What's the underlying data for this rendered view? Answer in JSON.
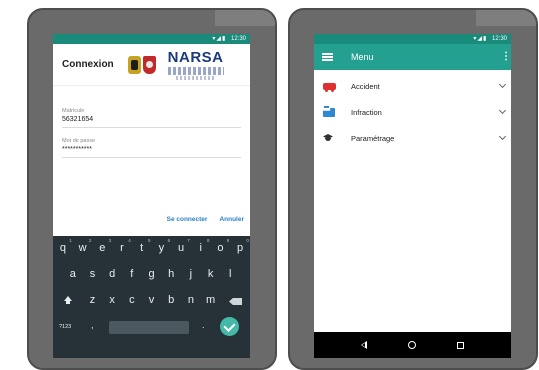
{
  "status": {
    "time": "12:30"
  },
  "login": {
    "title": "Connexion",
    "logo_text": "NARSA",
    "matricule_label": "Matricule",
    "matricule_value": "56321654",
    "password_label": "Mot de passe",
    "password_value": "***********",
    "connect_label": "Se connecter",
    "cancel_label": "Annuler"
  },
  "keyboard": {
    "row1": [
      {
        "k": "q",
        "n": "1"
      },
      {
        "k": "w",
        "n": "2"
      },
      {
        "k": "e",
        "n": "3"
      },
      {
        "k": "r",
        "n": "4"
      },
      {
        "k": "t",
        "n": "5"
      },
      {
        "k": "y",
        "n": "6"
      },
      {
        "k": "u",
        "n": "7"
      },
      {
        "k": "i",
        "n": "8"
      },
      {
        "k": "o",
        "n": "9"
      },
      {
        "k": "p",
        "n": "0"
      }
    ],
    "row2": [
      "a",
      "s",
      "d",
      "f",
      "g",
      "h",
      "j",
      "k",
      "l"
    ],
    "row3": [
      "z",
      "x",
      "c",
      "v",
      "b",
      "n",
      "m"
    ],
    "symbols_label": "?123",
    "comma": ",",
    "period": "."
  },
  "menu": {
    "title": "Menu",
    "items": [
      {
        "label": "Accident",
        "icon": "car-crash-icon",
        "color": "#e03131"
      },
      {
        "label": "Infraction",
        "icon": "traffic-ticket-icon",
        "color": "#2f88d4"
      },
      {
        "label": "Paramétrage",
        "icon": "settings-cap-icon",
        "color": "#333333"
      }
    ]
  },
  "colors": {
    "primary": "#23a08f",
    "primary_dark": "#1a8a7b",
    "accent": "#2b80c9",
    "keyboard_bg": "#263238"
  }
}
